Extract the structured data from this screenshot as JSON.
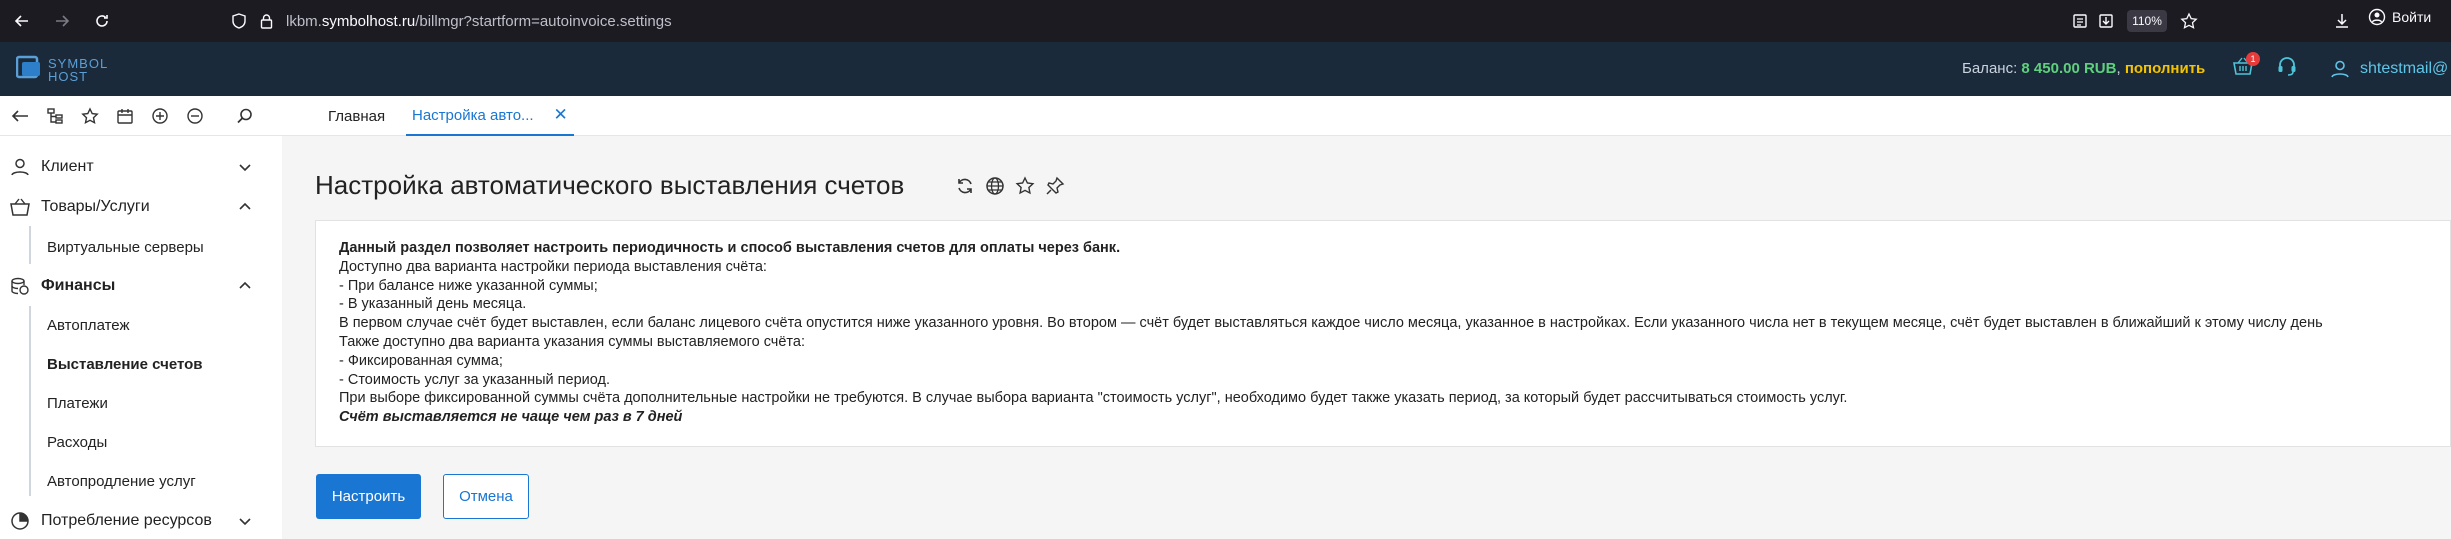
{
  "browser": {
    "url_prefix": "lkbm.",
    "url_domain": "symbolhost.ru",
    "url_path": "/billmgr?startform=autoinvoice.settings",
    "zoom": "110%",
    "login_label": "Войти"
  },
  "header": {
    "logo_line1": "SYMBOL",
    "logo_line2": "HOST",
    "balance_label": "Баланс:",
    "balance_amount": "8 450.00 RUB",
    "balance_sep": ",",
    "pay_label": "пополнить",
    "cart_count": "1",
    "user": "shtestmail@"
  },
  "tabs": [
    {
      "label": "Главная"
    },
    {
      "label": "Настройка авто..."
    }
  ],
  "sidebar": {
    "client": "Клиент",
    "goods": "Товары/Услуги",
    "virtual_servers": "Виртуальные серверы",
    "finance": "Финансы",
    "autopay": "Автоплатеж",
    "invoicing": "Выставление счетов",
    "payments": "Платежи",
    "expenses": "Расходы",
    "autorenew": "Автопродление услуг",
    "resources": "Потребление ресурсов"
  },
  "main": {
    "title": "Настройка автоматического выставления счетов",
    "info_lines": [
      "Данный раздел позволяет настроить периодичность и способ выставления счетов для оплаты через банк.",
      "Доступно два варианта настройки периода выставления счёта:",
      "- При балансе ниже указанной суммы;",
      "- В указанный день месяца.",
      "В первом случае счёт будет выставлен, если баланс лицевого счёта опустится ниже указанного уровня. Во втором — счёт будет выставляться каждое число месяца, указанное в настройках. Если указанного числа нет в текущем месяце, счёт будет выставлен в ближайший к этому числу день",
      "Также доступно два варианта указания суммы выставляемого счёта:",
      "- Фиксированная сумма;",
      "- Стоимость услуг за указанный период.",
      "При выборе фиксированной суммы счёта дополнительные настройки не требуются. В случае выбора варианта \"стоимость услуг\", необходимо будет также указать период, за который будет рассчитываться стоимость услуг.",
      "Счёт выставляется не чаще чем раз в 7 дней"
    ],
    "configure_label": "Настроить",
    "cancel_label": "Отмена"
  },
  "colors": {
    "accent": "#1976d2",
    "header_bg": "#1b2a3b",
    "balance_green": "#5fd17d",
    "pay_yellow": "#f5c400"
  }
}
